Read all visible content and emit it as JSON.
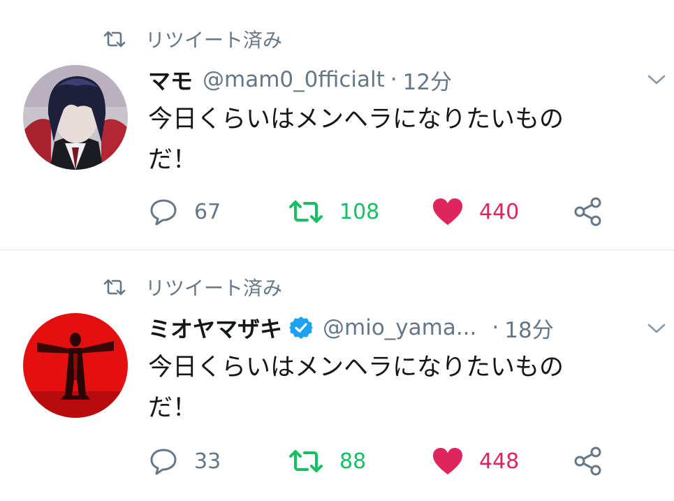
{
  "tweets": [
    {
      "retweet_label": "リツイート済み",
      "name": "マモ",
      "handle": "@mam0_0fficialt",
      "separator": "·",
      "time": "12分",
      "text_line1": "今日くらいはメンヘラになりたいもの",
      "text_line2": "だ！",
      "replies": "67",
      "retweets": "108",
      "likes": "440",
      "verified": false
    },
    {
      "retweet_label": "リツイート済み",
      "name": "ミオヤマザキ",
      "handle": "@mio_yama...",
      "separator": "·",
      "time": "18分",
      "text_line1": "今日くらいはメンヘラになりたいもの",
      "text_line2": "だ！",
      "replies": "33",
      "retweets": "88",
      "likes": "448",
      "verified": true
    }
  ],
  "colors": {
    "retweet_green": "#17bf63",
    "like_red": "#e0245e",
    "meta_gray": "#657786",
    "verified_blue": "#1da1f2"
  },
  "icons": [
    "retweet-icon",
    "reply-icon",
    "like-icon",
    "share-icon",
    "chevron-down-icon",
    "verified-icon"
  ]
}
